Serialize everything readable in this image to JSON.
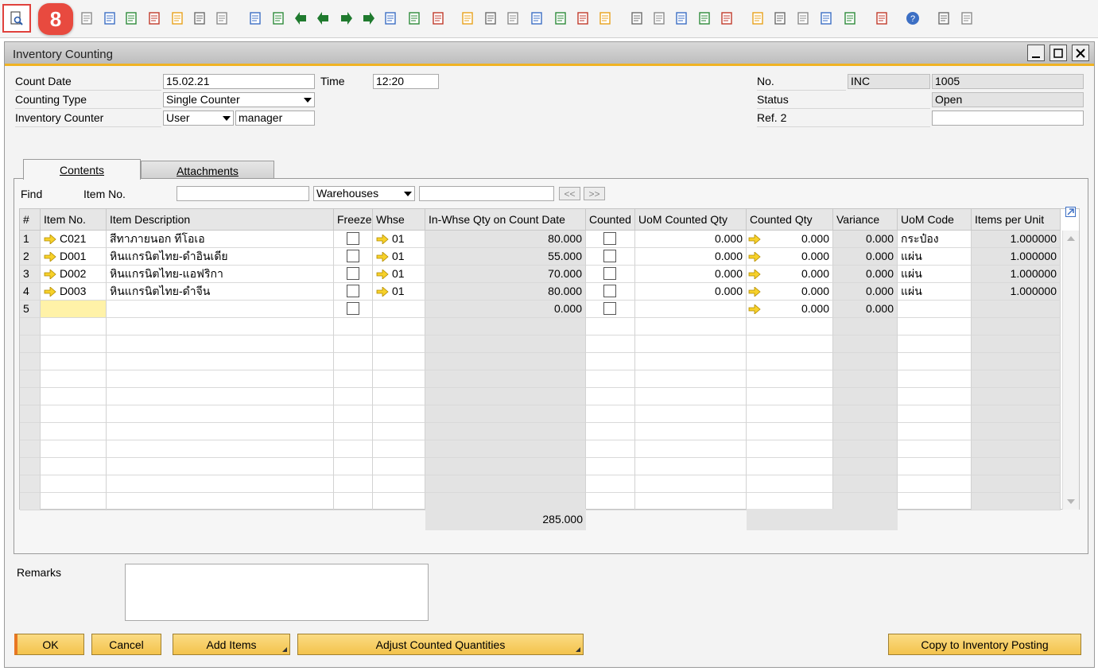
{
  "step_badge": "8",
  "toolbar": {
    "icons": [
      "preview-icon",
      "print-icon",
      "email-icon",
      "excel-icon",
      "word-icon",
      "pdf-icon",
      "move-icon",
      "lock-icon",
      "find-icon",
      "add-icon",
      "first-record-icon",
      "previous-record-icon",
      "next-record-icon",
      "last-record-icon",
      "refresh-icon",
      "filter-icon",
      "sort-icon",
      "base-document-icon",
      "target-document-icon",
      "gross-profit-icon",
      "journal-icon",
      "chart-icon",
      "report-icon",
      "query-icon",
      "edit-icon",
      "new-document-icon",
      "approve-icon",
      "message-icon",
      "chat-icon",
      "calendar-icon",
      "mail-icon",
      "layout-icon",
      "org-icon",
      "user-icon",
      "web-icon",
      "help-icon",
      "form-settings-icon",
      "transaction-icon"
    ]
  },
  "window": {
    "title": "Inventory Counting"
  },
  "header": {
    "count_date_label": "Count Date",
    "count_date": "15.02.21",
    "time_label": "Time",
    "time": "12:20",
    "counting_type_label": "Counting Type",
    "counting_type": "Single Counter",
    "inventory_counter_label": "Inventory Counter",
    "counter_type": "User",
    "counter_name": "manager",
    "no_label": "No.",
    "series": "INC",
    "doc_number": "1005",
    "status_label": "Status",
    "status": "Open",
    "ref2_label": "Ref. 2",
    "ref2": ""
  },
  "tabs": [
    {
      "label": "Contents"
    },
    {
      "label": "Attachments"
    }
  ],
  "find": {
    "label": "Find",
    "field_label": "Item No.",
    "value": "",
    "warehouse_select": "Warehouses",
    "warehouse_value": "",
    "prev_label": "<<",
    "next_label": ">>"
  },
  "grid": {
    "columns": [
      "#",
      "Item No.",
      "Item Description",
      "Freeze",
      "Whse",
      "In-Whse Qty on Count Date",
      "Counted",
      "UoM Counted Qty",
      "Counted Qty",
      "Variance",
      "UoM Code",
      "Items per Unit"
    ],
    "rows": [
      {
        "num": "1",
        "item_no": "C021",
        "desc": "สีทาภายนอก ทีโอเอ",
        "freeze": false,
        "whse": "01",
        "inwhse_qty": "80.000",
        "counted": false,
        "uom_counted_qty": "0.000",
        "counted_qty": "0.000",
        "variance": "0.000",
        "uom_code": "กระป๋อง",
        "items_per_unit": "1.000000"
      },
      {
        "num": "2",
        "item_no": "D001",
        "desc": "หินแกรนิตไทย-ดำอินเดีย",
        "freeze": false,
        "whse": "01",
        "inwhse_qty": "55.000",
        "counted": false,
        "uom_counted_qty": "0.000",
        "counted_qty": "0.000",
        "variance": "0.000",
        "uom_code": "แผ่น",
        "items_per_unit": "1.000000"
      },
      {
        "num": "3",
        "item_no": "D002",
        "desc": "หินแกรนิตไทย-แอฟริกา",
        "freeze": false,
        "whse": "01",
        "inwhse_qty": "70.000",
        "counted": false,
        "uom_counted_qty": "0.000",
        "counted_qty": "0.000",
        "variance": "0.000",
        "uom_code": "แผ่น",
        "items_per_unit": "1.000000"
      },
      {
        "num": "4",
        "item_no": "D003",
        "desc": "หินแกรนิตไทย-ดำจีน",
        "freeze": false,
        "whse": "01",
        "inwhse_qty": "80.000",
        "counted": false,
        "uom_counted_qty": "0.000",
        "counted_qty": "0.000",
        "variance": "0.000",
        "uom_code": "แผ่น",
        "items_per_unit": "1.000000"
      },
      {
        "num": "5",
        "item_no": "",
        "desc": "",
        "freeze": false,
        "whse": "",
        "inwhse_qty": "0.000",
        "counted": false,
        "uom_counted_qty": "",
        "counted_qty": "0.000",
        "variance": "0.000",
        "uom_code": "",
        "items_per_unit": ""
      }
    ],
    "total_inwhse_qty": "285.000"
  },
  "remarks": {
    "label": "Remarks",
    "value": ""
  },
  "buttons": {
    "ok": "OK",
    "cancel": "Cancel",
    "add_items": "Add Items",
    "adjust": "Adjust Counted Quantities",
    "copy_to": "Copy to Inventory Posting"
  }
}
